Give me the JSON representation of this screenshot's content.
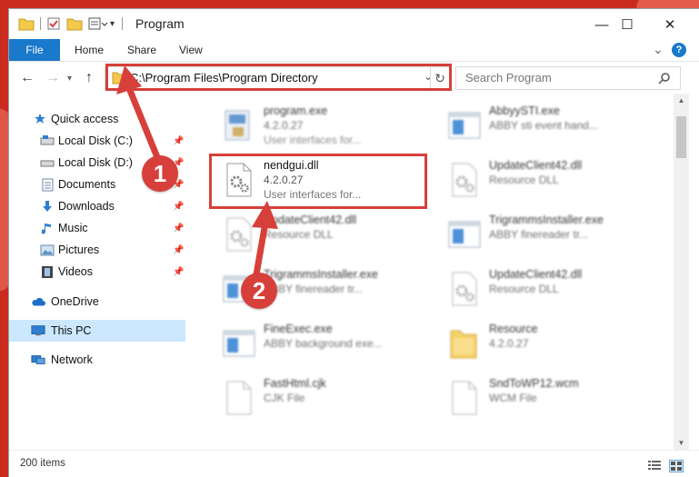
{
  "window": {
    "title": "Program",
    "minimize_glyph": "—",
    "maximize_glyph": "☐",
    "close_glyph": "✕"
  },
  "ribbon": {
    "tabs": [
      "File",
      "Home",
      "Share",
      "View"
    ],
    "expand_glyph": "⌄",
    "help_glyph": "?"
  },
  "address": {
    "path": "C:\\Program Files\\Program Directory",
    "search_placeholder": "Search Program"
  },
  "sidebar": {
    "items": [
      {
        "label": "Quick access",
        "icon": "star-icon"
      },
      {
        "label": "Local Disk (C:)",
        "icon": "drive-icon",
        "pinned": true
      },
      {
        "label": "Local Disk (D:)",
        "icon": "drive-icon",
        "pinned": true
      },
      {
        "label": "Documents",
        "icon": "documents-icon",
        "pinned": true
      },
      {
        "label": "Downloads",
        "icon": "downloads-icon",
        "pinned": true
      },
      {
        "label": "Music",
        "icon": "music-icon",
        "pinned": true
      },
      {
        "label": "Pictures",
        "icon": "pictures-icon",
        "pinned": true
      },
      {
        "label": "Videos",
        "icon": "videos-icon",
        "pinned": true
      },
      {
        "label": "OneDrive",
        "icon": "cloud-icon"
      },
      {
        "label": "This PC",
        "icon": "computer-icon",
        "selected": true
      },
      {
        "label": "Network",
        "icon": "network-icon"
      }
    ]
  },
  "files": {
    "left": [
      {
        "name": "program.exe",
        "line1": "4.2.0.27",
        "line2": "User interfaces for...",
        "icon": "exe-icon"
      },
      {
        "name": "nendgui.dll",
        "line1": "4.2.0.27",
        "line2": "User interfaces for...",
        "icon": "dll-gear-icon",
        "highlighted": true
      },
      {
        "name": "UpdateClient42.dll",
        "line1": "Resource DLL",
        "line2": "",
        "icon": "dll-gear-icon"
      },
      {
        "name": "TrigrammsInstaller.exe",
        "line1": "ABBY finereader tr...",
        "line2": "",
        "icon": "exe-window-icon"
      },
      {
        "name": "FineExec.exe",
        "line1": "ABBY background exe...",
        "line2": "",
        "icon": "exe-window-icon"
      },
      {
        "name": "FastHtml.cjk",
        "line1": "CJK File",
        "line2": "",
        "icon": "blank-file-icon"
      }
    ],
    "right": [
      {
        "name": "AbbyySTI.exe",
        "line1": "ABBY sti event hand...",
        "line2": "",
        "icon": "exe-window-icon"
      },
      {
        "name": "UpdateClient42.dll",
        "line1": "Resource DLL",
        "line2": "",
        "icon": "dll-gear-icon"
      },
      {
        "name": "TrigrammsInstaller.exe",
        "line1": "ABBY finereader tr...",
        "line2": "",
        "icon": "exe-window-icon"
      },
      {
        "name": "UpdateClient42.dll",
        "line1": "Resource DLL",
        "line2": "",
        "icon": "dll-gear-icon"
      },
      {
        "name": "Resource",
        "line1": "4.2.0.27",
        "line2": "",
        "icon": "folder-icon"
      },
      {
        "name": "SndToWP12.wcm",
        "line1": "WCM File",
        "line2": "",
        "icon": "blank-file-icon"
      }
    ]
  },
  "status": {
    "items_count": "200 items"
  },
  "annotations": {
    "step1": "1",
    "step2": "2"
  },
  "colors": {
    "accent": "#1979ca",
    "highlight": "#d7403a",
    "selected": "#cce8ff",
    "background": "#c92b1e"
  }
}
